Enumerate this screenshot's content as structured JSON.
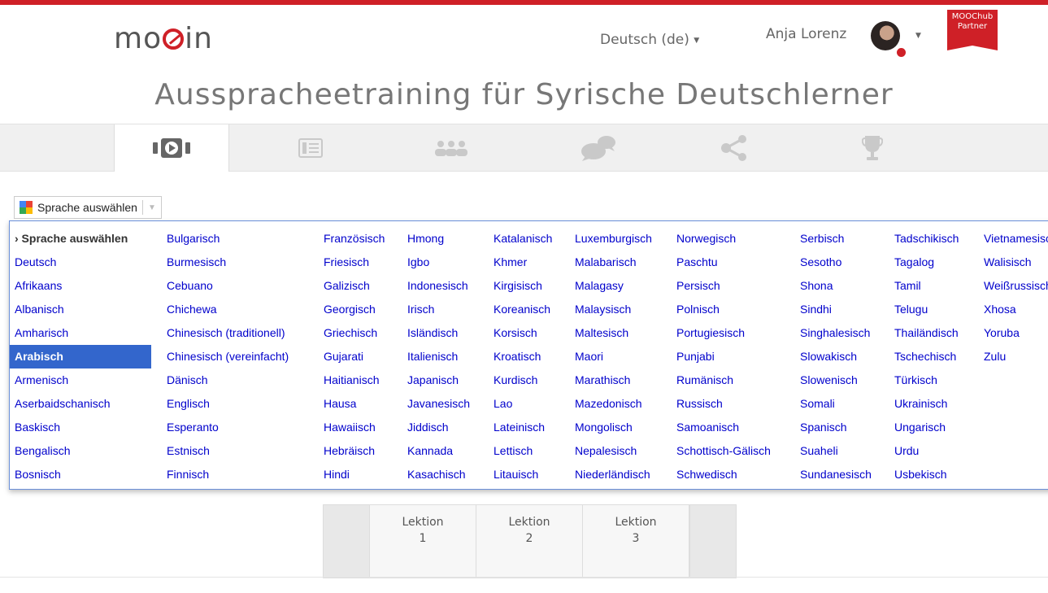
{
  "brand": {
    "logo_prefix": "mo",
    "logo_suffix": "in",
    "accent": "#cf2027"
  },
  "header": {
    "language_label": "Deutsch (de)",
    "user_name": "Anja Lorenz",
    "partner_badge": [
      "MOOChub",
      "Partner"
    ]
  },
  "course": {
    "title": "Ausspracheetraining für Syrische Deutschlerner"
  },
  "tabs": [
    {
      "icon": "video-icon",
      "active": true
    },
    {
      "icon": "document-icon",
      "active": false
    },
    {
      "icon": "group-icon",
      "active": false
    },
    {
      "icon": "chat-icon",
      "active": false
    },
    {
      "icon": "share-icon",
      "active": false
    },
    {
      "icon": "trophy-icon",
      "active": false
    }
  ],
  "translate": {
    "label": "Sprache auswählen",
    "selected": "Arabisch",
    "columns": [
      [
        "› Sprache auswählen",
        "Deutsch",
        "Afrikaans",
        "Albanisch",
        "Amharisch",
        "Arabisch",
        "Armenisch",
        "Aserbaidschanisch",
        "Baskisch",
        "Bengalisch",
        "Bosnisch"
      ],
      [
        "Bulgarisch",
        "Burmesisch",
        "Cebuano",
        "Chichewa",
        "Chinesisch (traditionell)",
        "Chinesisch (vereinfacht)",
        "Dänisch",
        "Englisch",
        "Esperanto",
        "Estnisch",
        "Finnisch"
      ],
      [
        "Französisch",
        "Friesisch",
        "Galizisch",
        "Georgisch",
        "Griechisch",
        "Gujarati",
        "Haitianisch",
        "Hausa",
        "Hawaiisch",
        "Hebräisch",
        "Hindi"
      ],
      [
        "Hmong",
        "Igbo",
        "Indonesisch",
        "Irisch",
        "Isländisch",
        "Italienisch",
        "Japanisch",
        "Javanesisch",
        "Jiddisch",
        "Kannada",
        "Kasachisch"
      ],
      [
        "Katalanisch",
        "Khmer",
        "Kirgisisch",
        "Koreanisch",
        "Korsisch",
        "Kroatisch",
        "Kurdisch",
        "Lao",
        "Lateinisch",
        "Lettisch",
        "Litauisch"
      ],
      [
        "Luxemburgisch",
        "Malabarisch",
        "Malagasy",
        "Malaysisch",
        "Maltesisch",
        "Maori",
        "Marathisch",
        "Mazedonisch",
        "Mongolisch",
        "Nepalesisch",
        "Niederländisch"
      ],
      [
        "Norwegisch",
        "Paschtu",
        "Persisch",
        "Polnisch",
        "Portugiesisch",
        "Punjabi",
        "Rumänisch",
        "Russisch",
        "Samoanisch",
        "Schottisch-Gälisch",
        "Schwedisch"
      ],
      [
        "Serbisch",
        "Sesotho",
        "Shona",
        "Sindhi",
        "Singhalesisch",
        "Slowakisch",
        "Slowenisch",
        "Somali",
        "Spanisch",
        "Suaheli",
        "Sundanesisch"
      ],
      [
        "Tadschikisch",
        "Tagalog",
        "Tamil",
        "Telugu",
        "Thailändisch",
        "Tschechisch",
        "Türkisch",
        "Ukrainisch",
        "Ungarisch",
        "Urdu",
        "Usbekisch"
      ],
      [
        "Vietnamesisch",
        "Walisisch",
        "Weißrussisch",
        "Xhosa",
        "Yoruba",
        "Zulu"
      ]
    ]
  },
  "lessons": [
    {
      "word": "Lektion",
      "num": "1"
    },
    {
      "word": "Lektion",
      "num": "2"
    },
    {
      "word": "Lektion",
      "num": "3"
    }
  ]
}
